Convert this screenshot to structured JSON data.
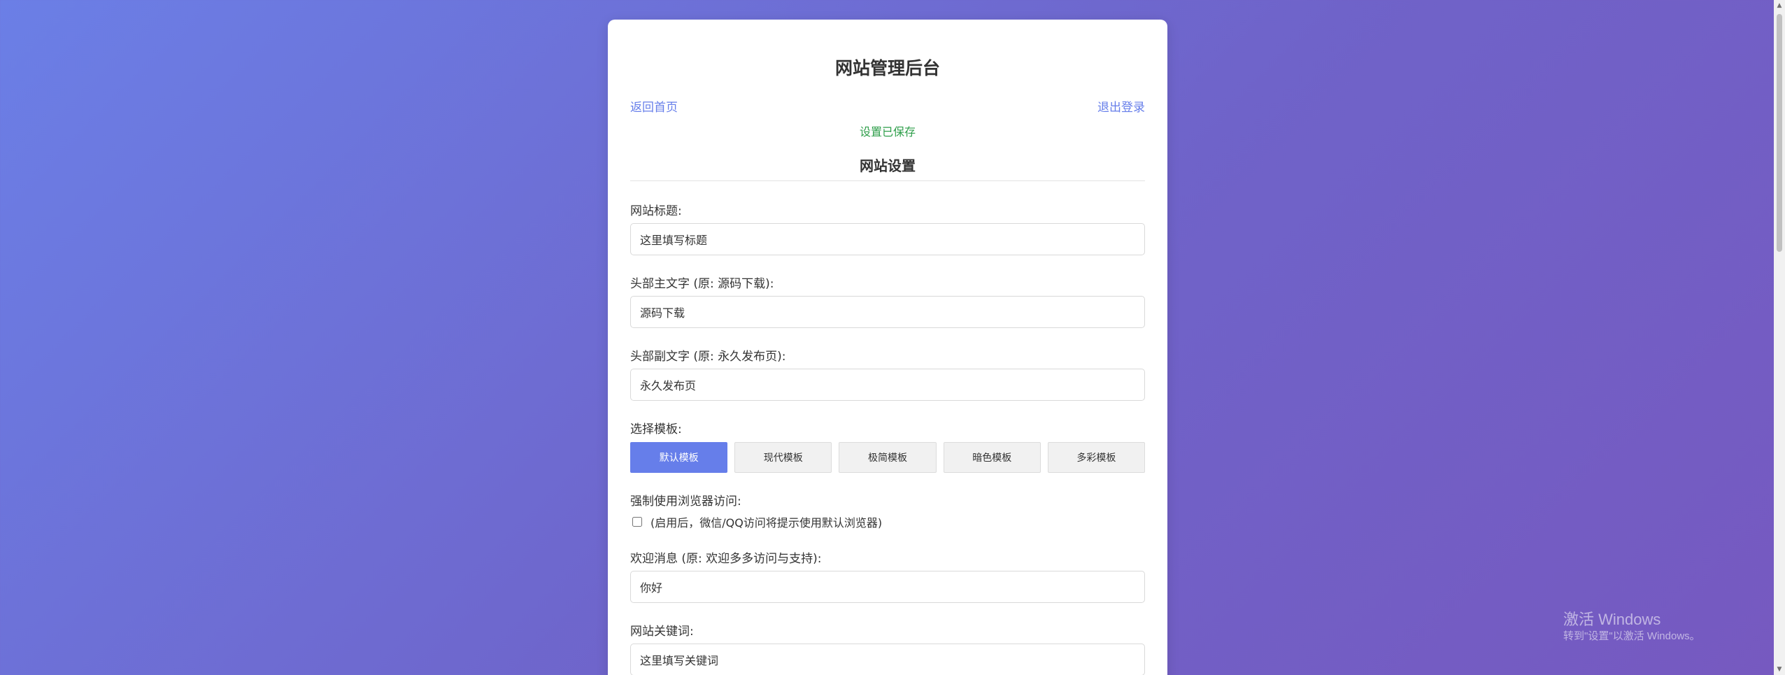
{
  "header": {
    "title": "网站管理后台",
    "home_link": "返回首页",
    "logout_link": "退出登录",
    "status_message": "设置已保存"
  },
  "section": {
    "title": "网站设置"
  },
  "fields": {
    "site_title": {
      "label": "网站标题:",
      "value": "这里填写标题"
    },
    "header_main": {
      "label": "头部主文字 (原: 源码下载):",
      "value": "源码下载"
    },
    "header_sub": {
      "label": "头部副文字 (原: 永久发布页):",
      "value": "永久发布页"
    },
    "welcome": {
      "label": "欢迎消息 (原: 欢迎多多访问与支持):",
      "value": "你好"
    },
    "keywords": {
      "label": "网站关键词:",
      "value": "这里填写关键词"
    }
  },
  "templates": {
    "label": "选择模板:",
    "options": [
      "默认模板",
      "现代模板",
      "极简模板",
      "暗色模板",
      "多彩模板"
    ],
    "selected": "默认模板"
  },
  "force_browser": {
    "label": "强制使用浏览器访问:",
    "checked": false,
    "hint": "(启用后，微信/QQ访问将提示使用默认浏览器)"
  },
  "watermark": {
    "title": "激活 Windows",
    "subtitle": "转到\"设置\"以激活 Windows。"
  },
  "colors": {
    "accent": "#667eea",
    "success": "#2e9e4a",
    "background_start": "#6b7fe6",
    "background_end": "#7659c0"
  }
}
